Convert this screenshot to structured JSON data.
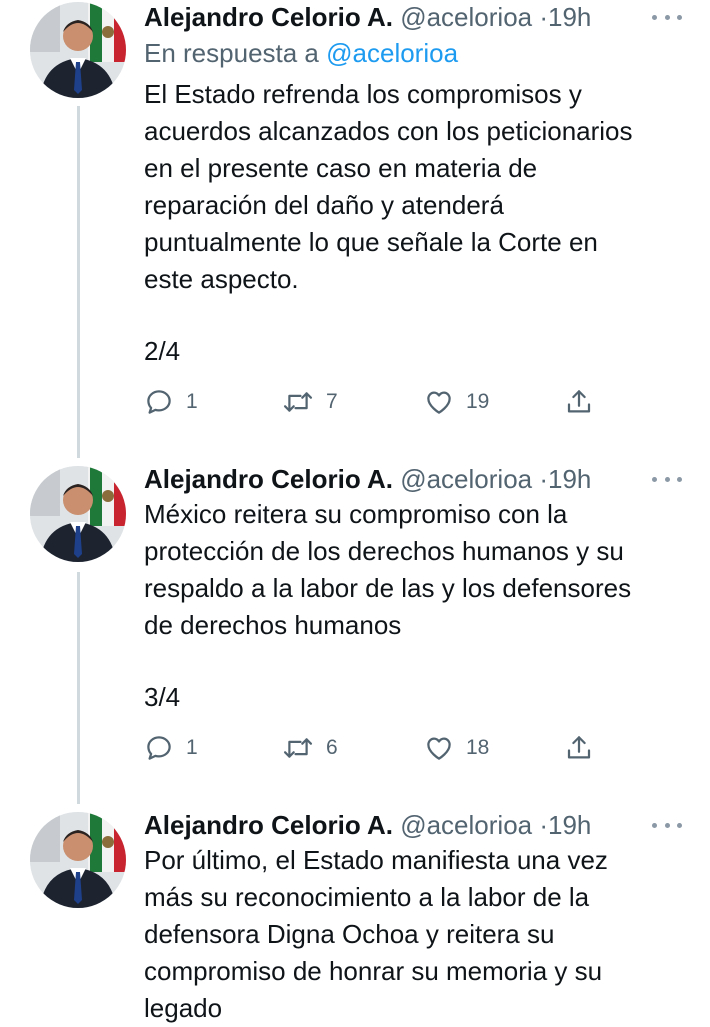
{
  "colors": {
    "text": "#0f1419",
    "secondary": "#536471",
    "link": "#1d9bf0",
    "thread_line": "#cfd9de"
  },
  "tweets": [
    {
      "name": "Alejandro Celorio A.",
      "handle": "@acelorioa",
      "dot": "·",
      "time": "19h",
      "reply_prefix": "En respuesta a ",
      "reply_mention": "@acelorioa",
      "text": "El Estado refrenda los compromisos y\nacuerdos alcanzados con los peticionarios\nen el presente caso en materia de\nreparación del daño y atenderá\npuntualmente lo que señale la Corte en\neste aspecto.",
      "counter": "2/4",
      "replies": "1",
      "retweets": "7",
      "likes": "19",
      "icons": [
        "reply-icon",
        "retweet-icon",
        "like-icon",
        "share-icon",
        "more-icon"
      ]
    },
    {
      "name": "Alejandro Celorio A.",
      "handle": "@acelorioa",
      "dot": "·",
      "time": "19h",
      "text": "México reitera su compromiso con la\nprotección de los derechos humanos y su\nrespaldo a la labor de las y los defensores\nde derechos humanos",
      "counter": "3/4",
      "replies": "1",
      "retweets": "6",
      "likes": "18",
      "icons": [
        "reply-icon",
        "retweet-icon",
        "like-icon",
        "share-icon",
        "more-icon"
      ]
    },
    {
      "name": "Alejandro Celorio A.",
      "handle": "@acelorioa",
      "dot": "·",
      "time": "19h",
      "text": "Por último, el Estado manifiesta una vez\nmás su reconocimiento a la labor de la\ndefensora Digna Ochoa y reitera su\ncompromiso de honrar su memoria y su\nlegado"
    }
  ]
}
